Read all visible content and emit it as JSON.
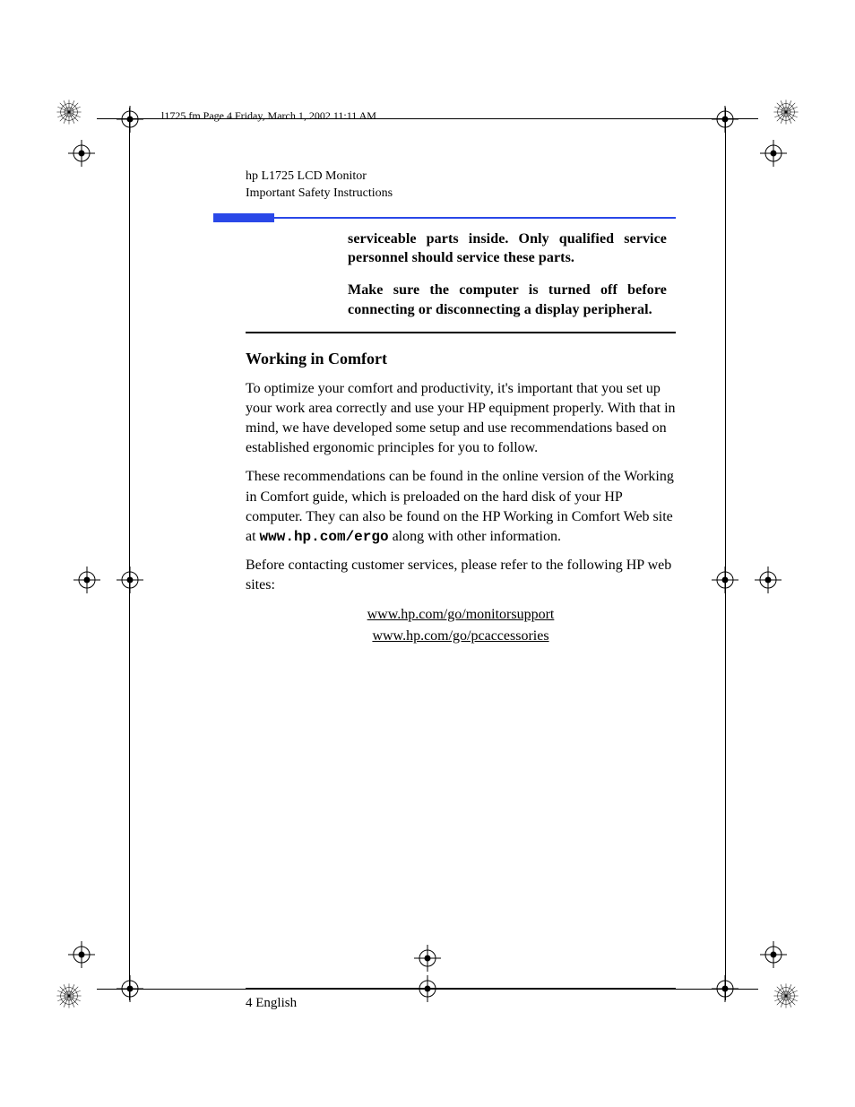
{
  "file_header": "l1725.fm  Page 4  Friday, March 1, 2002  11:11 AM",
  "running_head": {
    "line1": "hp L1725 LCD Monitor",
    "line2": "Important Safety Instructions"
  },
  "warnings": {
    "p1": "serviceable parts inside. Only qualified service personnel should service these parts.",
    "p2": "Make sure the computer is turned off before connecting or disconnecting a display peripheral."
  },
  "section_title": "Working in Comfort",
  "paragraphs": {
    "p1": "To optimize your comfort and productivity, it's important that you set up your work area correctly and use your HP equipment properly. With that in mind, we have developed some setup and use recommendations based on established ergonomic principles for you to follow.",
    "p2a": "These recommendations can be found in the online version of the Working in Comfort guide, which is preloaded on the hard disk of your HP computer. They can also be found on the HP Working in Comfort Web site at ",
    "p2_url": "www.hp.com/ergo",
    "p2b": " along with other information.",
    "p3": "Before contacting customer services, please refer to the following HP web sites:"
  },
  "links": {
    "l1": "www.hp.com/go/monitorsupport",
    "l2": "www.hp.com/go/pcaccessories"
  },
  "footer": "4 English"
}
